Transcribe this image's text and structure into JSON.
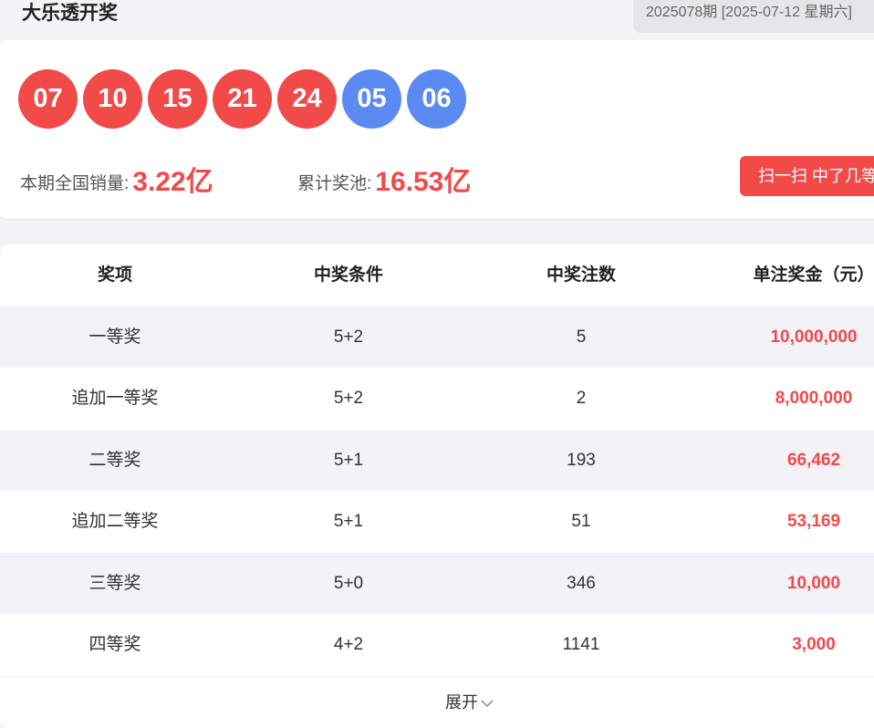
{
  "header": {
    "title": "大乐透开奖",
    "issue": "2025078期 [2025-07-12 星期六]"
  },
  "draw": {
    "red_balls": [
      "07",
      "10",
      "15",
      "21",
      "24"
    ],
    "blue_balls": [
      "05",
      "06"
    ],
    "colors": {
      "red": "#f24949",
      "blue": "#5b8af3"
    }
  },
  "stats": {
    "sales_label": "本期全国销量:",
    "sales_value": "3.22亿",
    "pool_label": "累计奖池:",
    "pool_value": "16.53亿"
  },
  "scan_button": {
    "label": "扫一扫 中了几等"
  },
  "table": {
    "columns": [
      "奖项",
      "中奖条件",
      "中奖注数",
      "单注奖金（元）"
    ],
    "rows": [
      {
        "name": "一等奖",
        "condition": "5+2",
        "count": "5",
        "prize": "10,000,000"
      },
      {
        "name": "追加一等奖",
        "condition": "5+2",
        "count": "2",
        "prize": "8,000,000"
      },
      {
        "name": "二等奖",
        "condition": "5+1",
        "count": "193",
        "prize": "66,462"
      },
      {
        "name": "追加二等奖",
        "condition": "5+1",
        "count": "51",
        "prize": "53,169"
      },
      {
        "name": "三等奖",
        "condition": "5+0",
        "count": "346",
        "prize": "10,000"
      },
      {
        "name": "四等奖",
        "condition": "4+2",
        "count": "1141",
        "prize": "3,000"
      }
    ]
  },
  "expand": {
    "label": "展开",
    "icon": "chevron-down-icon"
  }
}
